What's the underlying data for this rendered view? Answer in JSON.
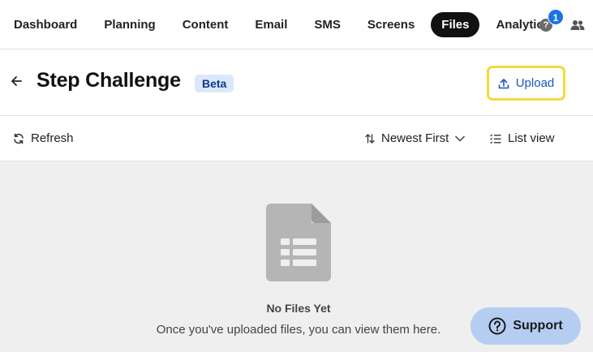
{
  "nav": {
    "items": [
      {
        "label": "Dashboard"
      },
      {
        "label": "Planning"
      },
      {
        "label": "Content"
      },
      {
        "label": "Email"
      },
      {
        "label": "SMS"
      },
      {
        "label": "Screens"
      },
      {
        "label": "Files"
      },
      {
        "label": "Analytics"
      }
    ],
    "active": "Files",
    "help_badge": "1",
    "help_icon": "question-circle-icon",
    "team_icon": "people-icon"
  },
  "header": {
    "title": "Step Challenge",
    "badge": "Beta",
    "upload_label": "Upload",
    "back_icon": "arrow-left-icon"
  },
  "toolbar": {
    "refresh_label": "Refresh",
    "sort_label": "Newest First",
    "view_label": "List view"
  },
  "empty_state": {
    "title": "No Files Yet",
    "message": "Once you've uploaded files, you can view them here.",
    "icon": "document-icon"
  },
  "support": {
    "label": "Support"
  },
  "colors": {
    "accent": "#1a56c4",
    "highlight_border": "#f5d93a",
    "badge_bg": "#dbe7fb",
    "support_bg": "#b6cdf2",
    "notification": "#1a73e8",
    "empty_bg": "#efefef"
  }
}
